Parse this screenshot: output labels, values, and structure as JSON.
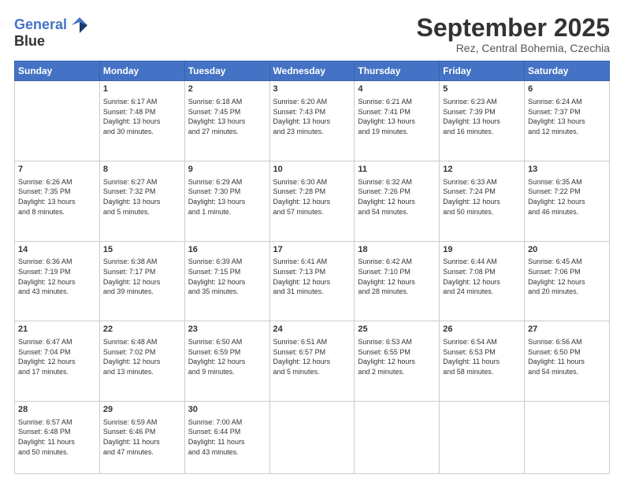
{
  "header": {
    "logo_line1": "General",
    "logo_line2": "Blue",
    "month": "September 2025",
    "location": "Rez, Central Bohemia, Czechia"
  },
  "weekdays": [
    "Sunday",
    "Monday",
    "Tuesday",
    "Wednesday",
    "Thursday",
    "Friday",
    "Saturday"
  ],
  "weeks": [
    [
      {
        "day": "",
        "text": ""
      },
      {
        "day": "1",
        "text": "Sunrise: 6:17 AM\nSunset: 7:48 PM\nDaylight: 13 hours\nand 30 minutes."
      },
      {
        "day": "2",
        "text": "Sunrise: 6:18 AM\nSunset: 7:45 PM\nDaylight: 13 hours\nand 27 minutes."
      },
      {
        "day": "3",
        "text": "Sunrise: 6:20 AM\nSunset: 7:43 PM\nDaylight: 13 hours\nand 23 minutes."
      },
      {
        "day": "4",
        "text": "Sunrise: 6:21 AM\nSunset: 7:41 PM\nDaylight: 13 hours\nand 19 minutes."
      },
      {
        "day": "5",
        "text": "Sunrise: 6:23 AM\nSunset: 7:39 PM\nDaylight: 13 hours\nand 16 minutes."
      },
      {
        "day": "6",
        "text": "Sunrise: 6:24 AM\nSunset: 7:37 PM\nDaylight: 13 hours\nand 12 minutes."
      }
    ],
    [
      {
        "day": "7",
        "text": "Sunrise: 6:26 AM\nSunset: 7:35 PM\nDaylight: 13 hours\nand 8 minutes."
      },
      {
        "day": "8",
        "text": "Sunrise: 6:27 AM\nSunset: 7:32 PM\nDaylight: 13 hours\nand 5 minutes."
      },
      {
        "day": "9",
        "text": "Sunrise: 6:29 AM\nSunset: 7:30 PM\nDaylight: 13 hours\nand 1 minute."
      },
      {
        "day": "10",
        "text": "Sunrise: 6:30 AM\nSunset: 7:28 PM\nDaylight: 12 hours\nand 57 minutes."
      },
      {
        "day": "11",
        "text": "Sunrise: 6:32 AM\nSunset: 7:26 PM\nDaylight: 12 hours\nand 54 minutes."
      },
      {
        "day": "12",
        "text": "Sunrise: 6:33 AM\nSunset: 7:24 PM\nDaylight: 12 hours\nand 50 minutes."
      },
      {
        "day": "13",
        "text": "Sunrise: 6:35 AM\nSunset: 7:22 PM\nDaylight: 12 hours\nand 46 minutes."
      }
    ],
    [
      {
        "day": "14",
        "text": "Sunrise: 6:36 AM\nSunset: 7:19 PM\nDaylight: 12 hours\nand 43 minutes."
      },
      {
        "day": "15",
        "text": "Sunrise: 6:38 AM\nSunset: 7:17 PM\nDaylight: 12 hours\nand 39 minutes."
      },
      {
        "day": "16",
        "text": "Sunrise: 6:39 AM\nSunset: 7:15 PM\nDaylight: 12 hours\nand 35 minutes."
      },
      {
        "day": "17",
        "text": "Sunrise: 6:41 AM\nSunset: 7:13 PM\nDaylight: 12 hours\nand 31 minutes."
      },
      {
        "day": "18",
        "text": "Sunrise: 6:42 AM\nSunset: 7:10 PM\nDaylight: 12 hours\nand 28 minutes."
      },
      {
        "day": "19",
        "text": "Sunrise: 6:44 AM\nSunset: 7:08 PM\nDaylight: 12 hours\nand 24 minutes."
      },
      {
        "day": "20",
        "text": "Sunrise: 6:45 AM\nSunset: 7:06 PM\nDaylight: 12 hours\nand 20 minutes."
      }
    ],
    [
      {
        "day": "21",
        "text": "Sunrise: 6:47 AM\nSunset: 7:04 PM\nDaylight: 12 hours\nand 17 minutes."
      },
      {
        "day": "22",
        "text": "Sunrise: 6:48 AM\nSunset: 7:02 PM\nDaylight: 12 hours\nand 13 minutes."
      },
      {
        "day": "23",
        "text": "Sunrise: 6:50 AM\nSunset: 6:59 PM\nDaylight: 12 hours\nand 9 minutes."
      },
      {
        "day": "24",
        "text": "Sunrise: 6:51 AM\nSunset: 6:57 PM\nDaylight: 12 hours\nand 5 minutes."
      },
      {
        "day": "25",
        "text": "Sunrise: 6:53 AM\nSunset: 6:55 PM\nDaylight: 12 hours\nand 2 minutes."
      },
      {
        "day": "26",
        "text": "Sunrise: 6:54 AM\nSunset: 6:53 PM\nDaylight: 11 hours\nand 58 minutes."
      },
      {
        "day": "27",
        "text": "Sunrise: 6:56 AM\nSunset: 6:50 PM\nDaylight: 11 hours\nand 54 minutes."
      }
    ],
    [
      {
        "day": "28",
        "text": "Sunrise: 6:57 AM\nSunset: 6:48 PM\nDaylight: 11 hours\nand 50 minutes."
      },
      {
        "day": "29",
        "text": "Sunrise: 6:59 AM\nSunset: 6:46 PM\nDaylight: 11 hours\nand 47 minutes."
      },
      {
        "day": "30",
        "text": "Sunrise: 7:00 AM\nSunset: 6:44 PM\nDaylight: 11 hours\nand 43 minutes."
      },
      {
        "day": "",
        "text": ""
      },
      {
        "day": "",
        "text": ""
      },
      {
        "day": "",
        "text": ""
      },
      {
        "day": "",
        "text": ""
      }
    ]
  ]
}
